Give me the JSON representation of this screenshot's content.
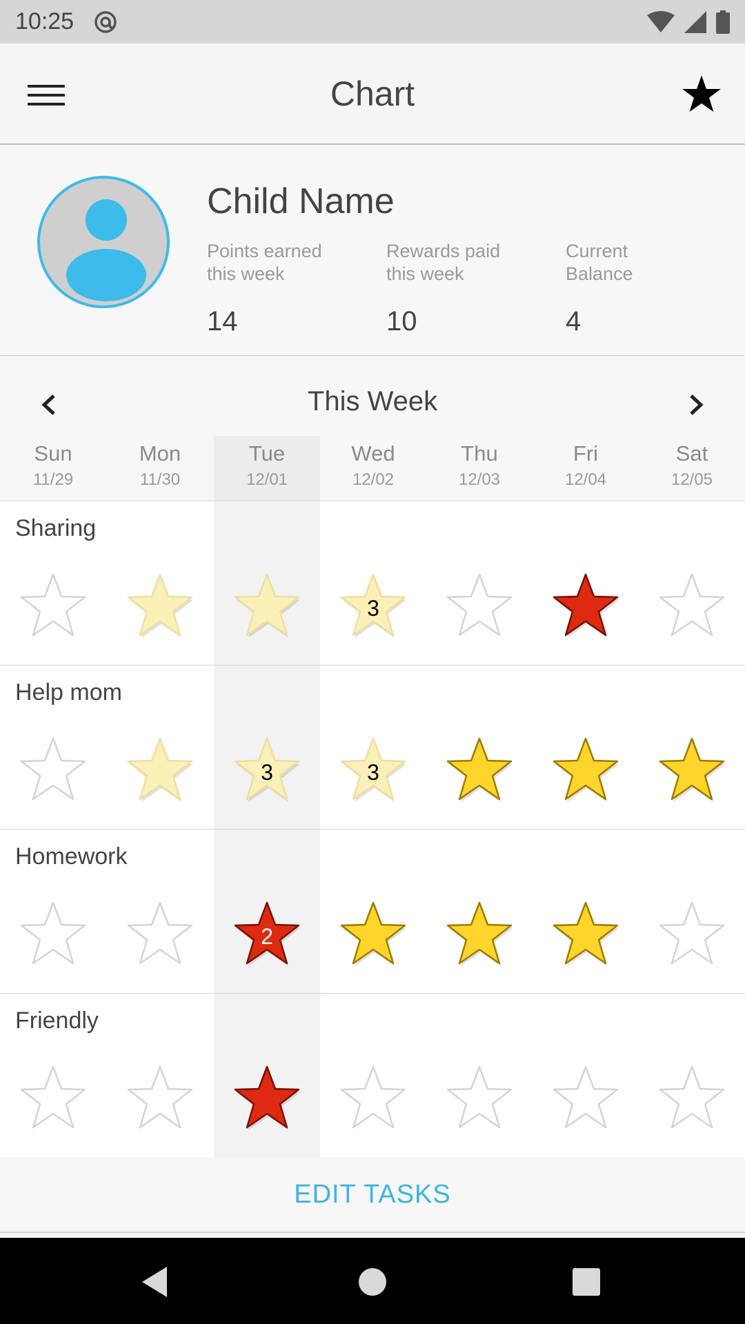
{
  "status_bar": {
    "time": "10:25",
    "icons": [
      "at-sign-icon",
      "wifi-icon",
      "signal-icon",
      "battery-icon"
    ]
  },
  "app_bar": {
    "title": "Chart",
    "menu_icon": "hamburger-menu-icon",
    "action_icon": "star-icon"
  },
  "profile": {
    "name": "Child Name",
    "avatar_icon": "person-avatar-icon",
    "stats": [
      {
        "label": "Points earned\nthis week",
        "value": "14"
      },
      {
        "label": "Rewards paid\nthis week",
        "value": "10"
      },
      {
        "label": "Current\nBalance",
        "value": "4"
      }
    ]
  },
  "week": {
    "title": "This Week",
    "highlighted_day": 2,
    "days": [
      {
        "name": "Sun",
        "date": "11/29"
      },
      {
        "name": "Mon",
        "date": "11/30"
      },
      {
        "name": "Tue",
        "date": "12/01"
      },
      {
        "name": "Wed",
        "date": "12/02"
      },
      {
        "name": "Thu",
        "date": "12/03"
      },
      {
        "name": "Fri",
        "date": "12/04"
      },
      {
        "name": "Sat",
        "date": "12/05"
      }
    ]
  },
  "star_styles": {
    "empty": {
      "fill": "#ffffff",
      "stroke": "#d4d4d4"
    },
    "pale": {
      "fill": "#fbf0b8",
      "stroke": "#ece0a0"
    },
    "gold": {
      "fill": "#fed52a",
      "stroke": "#a07a00"
    },
    "red": {
      "fill": "#dd2a10",
      "stroke": "#7a1000"
    }
  },
  "tasks": [
    {
      "name": "Sharing",
      "stars": [
        {
          "state": "empty",
          "count": ""
        },
        {
          "state": "pale",
          "count": ""
        },
        {
          "state": "pale",
          "count": ""
        },
        {
          "state": "pale",
          "count": "3"
        },
        {
          "state": "empty",
          "count": ""
        },
        {
          "state": "red",
          "count": ""
        },
        {
          "state": "empty",
          "count": ""
        }
      ]
    },
    {
      "name": "Help mom",
      "stars": [
        {
          "state": "empty",
          "count": ""
        },
        {
          "state": "pale",
          "count": ""
        },
        {
          "state": "pale",
          "count": "3"
        },
        {
          "state": "pale",
          "count": "3"
        },
        {
          "state": "gold",
          "count": ""
        },
        {
          "state": "gold",
          "count": ""
        },
        {
          "state": "gold",
          "count": ""
        }
      ]
    },
    {
      "name": "Homework",
      "stars": [
        {
          "state": "empty",
          "count": ""
        },
        {
          "state": "empty",
          "count": ""
        },
        {
          "state": "red",
          "count": "2"
        },
        {
          "state": "gold",
          "count": ""
        },
        {
          "state": "gold",
          "count": ""
        },
        {
          "state": "gold",
          "count": ""
        },
        {
          "state": "empty",
          "count": ""
        }
      ]
    },
    {
      "name": "Friendly",
      "stars": [
        {
          "state": "empty",
          "count": ""
        },
        {
          "state": "empty",
          "count": ""
        },
        {
          "state": "red",
          "count": ""
        },
        {
          "state": "empty",
          "count": ""
        },
        {
          "state": "empty",
          "count": ""
        },
        {
          "state": "empty",
          "count": ""
        },
        {
          "state": "empty",
          "count": ""
        }
      ]
    }
  ],
  "footer": {
    "edit_label": "EDIT TASKS"
  },
  "nav_bar": {
    "icons": [
      "back-triangle-icon",
      "home-circle-icon",
      "recents-square-icon"
    ]
  }
}
